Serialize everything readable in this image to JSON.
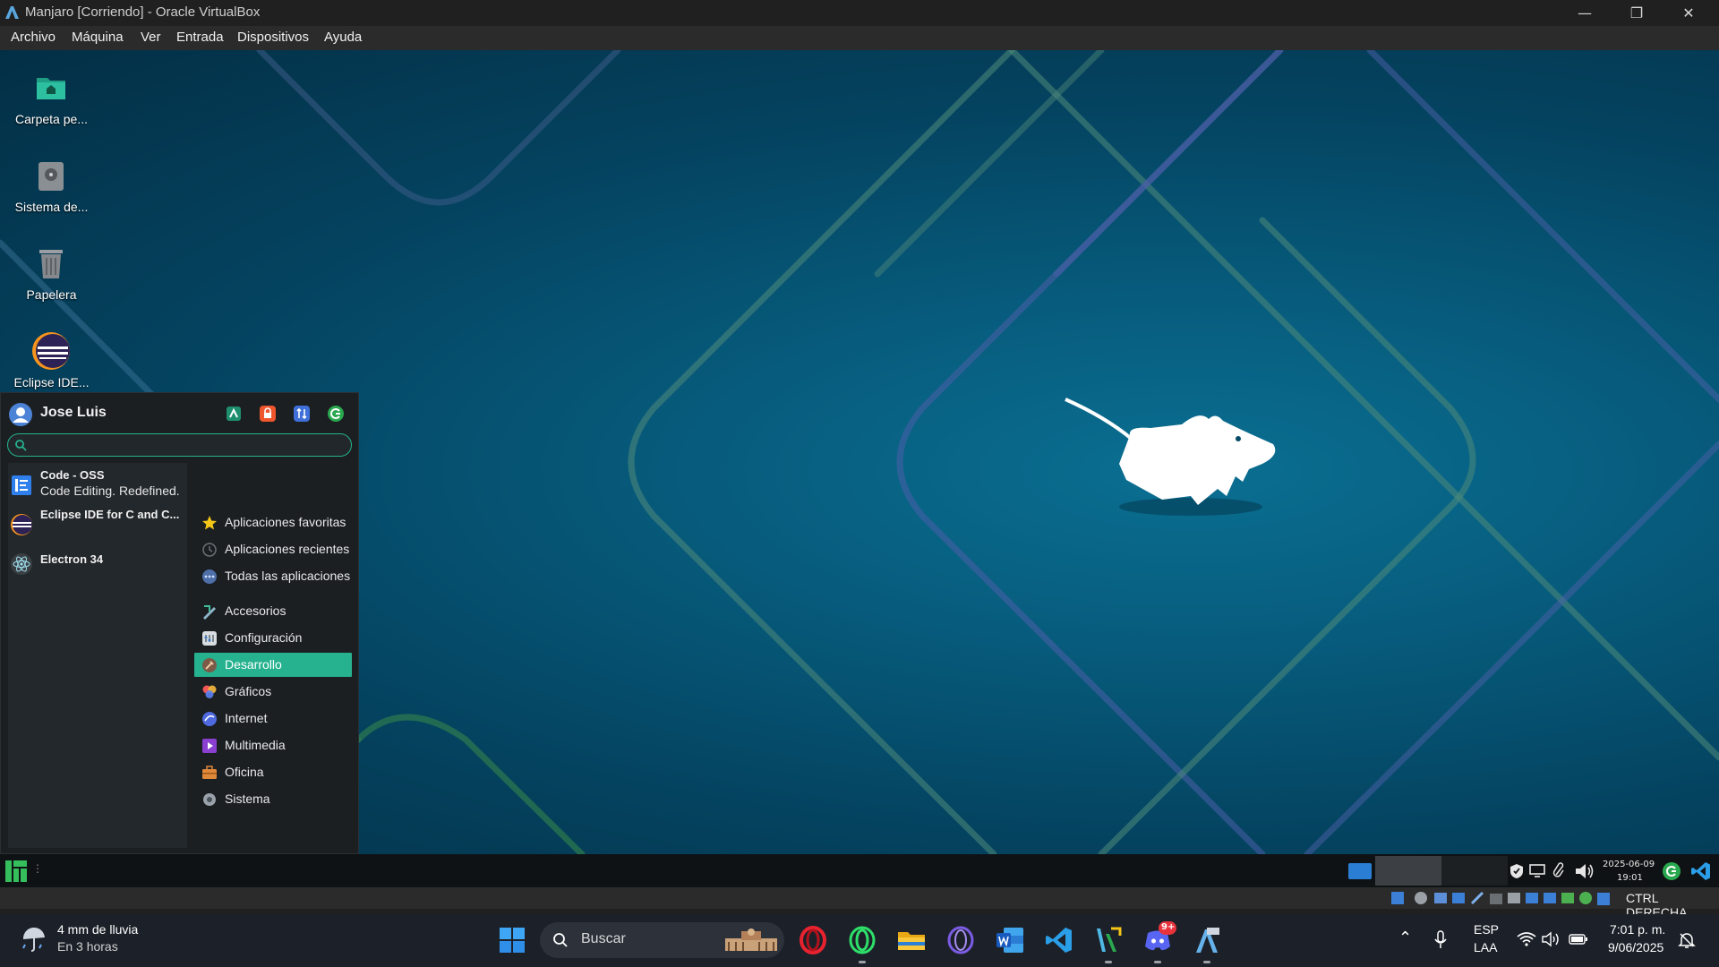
{
  "window": {
    "title": "Manjaro [Corriendo] - Oracle VirtualBox",
    "controls": {
      "minimize": "—",
      "restore": "❐",
      "close": "✕"
    }
  },
  "menubar": [
    "Archivo",
    "Máquina",
    "Ver",
    "Entrada",
    "Dispositivos",
    "Ayuda"
  ],
  "desktop": {
    "icons": [
      {
        "label": "Carpeta pe...",
        "icon": "home-folder-icon"
      },
      {
        "label": "Sistema de...",
        "icon": "filesystem-icon"
      },
      {
        "label": "Papelera",
        "icon": "trash-icon"
      },
      {
        "label": "Eclipse IDE...",
        "icon": "eclipse-icon"
      }
    ]
  },
  "whisker": {
    "user": "Jose Luis",
    "header_actions": [
      "settings-icon",
      "lock-icon",
      "switch-user-icon",
      "logout-icon"
    ],
    "search": {
      "value": "",
      "placeholder": ""
    },
    "favorites": [
      {
        "title": "Code - OSS",
        "subtitle": "Code Editing. Redefined."
      },
      {
        "title": "Eclipse IDE for C and C...",
        "subtitle": ""
      },
      {
        "title": "Electron 34",
        "subtitle": ""
      }
    ],
    "categories": [
      {
        "label": "Aplicaciones favoritas",
        "icon": "star-icon"
      },
      {
        "label": "Aplicaciones recientes",
        "icon": "clock-icon"
      },
      {
        "label": "Todas las aplicaciones",
        "icon": "dots-icon"
      },
      {
        "label": "Accesorios",
        "icon": "accessories-icon"
      },
      {
        "label": "Configuración",
        "icon": "settings-icon"
      },
      {
        "label": "Desarrollo",
        "icon": "development-icon",
        "active": true
      },
      {
        "label": "Gráficos",
        "icon": "graphics-icon"
      },
      {
        "label": "Internet",
        "icon": "internet-icon"
      },
      {
        "label": "Multimedia",
        "icon": "multimedia-icon"
      },
      {
        "label": "Oficina",
        "icon": "office-icon"
      },
      {
        "label": "Sistema",
        "icon": "system-icon"
      }
    ]
  },
  "guest_panel": {
    "clock_date": "2025-06-09",
    "clock_time": "19:01"
  },
  "vbox_status": {
    "host_key": "CTRL DERECHA"
  },
  "taskbar": {
    "weather": {
      "line1": "4 mm de lluvia",
      "line2": "En 3 horas"
    },
    "search_placeholder": "Buscar",
    "apps": [
      "opera-icon",
      "opera-gx-icon",
      "file-explorer-icon",
      "opera-air-icon",
      "word-icon",
      "vscode-icon",
      "virtualbox-manager-icon",
      "discord-icon",
      "virtualbox-icon"
    ],
    "discord_badge": "9+",
    "lang_line1": "ESP",
    "lang_line2": "LAA",
    "time": "7:01 p. m.",
    "date": "9/06/2025"
  },
  "colors": {
    "accent": "#26b28f",
    "guest_bg": "#075b7c",
    "taskbar": "#1c2129"
  }
}
